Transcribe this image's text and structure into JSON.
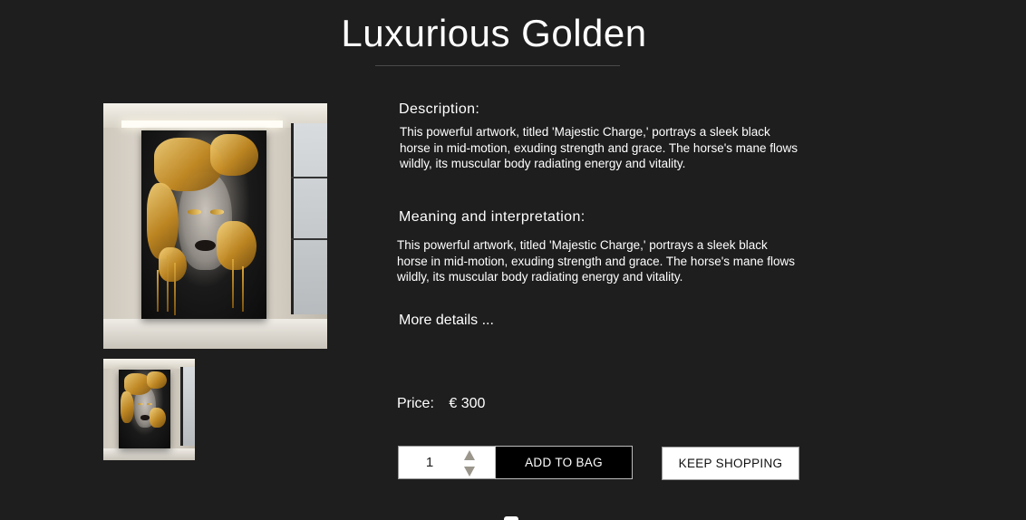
{
  "product": {
    "title": "Luxurious Golden",
    "description_heading": "Description:",
    "description_text": "This powerful artwork, titled 'Majestic Charge,' portrays a sleek black horse in mid-motion, exuding strength and grace. The horse's mane flows wildly, its muscular body radiating energy and vitality.",
    "meaning_heading": "Meaning and interpretation:",
    "meaning_text": "This powerful artwork, titled 'Majestic Charge,' portrays a sleek black horse in mid-motion, exuding strength and grace. The horse's mane flows wildly, its muscular body radiating energy and vitality.",
    "more_details_label": "More details ...",
    "price_label": "Price:",
    "price_value": "€ 300"
  },
  "cart": {
    "quantity": "1",
    "add_to_bag_label": "ADD TO BAG",
    "keep_shopping_label": "KEEP SHOPPING"
  },
  "icons": {
    "qty_up": "triangle-up-icon",
    "qty_down": "triangle-down-icon"
  },
  "colors": {
    "background": "#1e1e1e",
    "text": "#ffffff",
    "gold_accent": "#c48a22"
  }
}
